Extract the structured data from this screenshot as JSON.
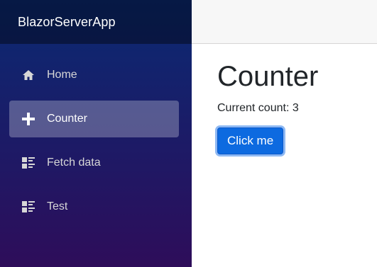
{
  "brand": "BlazorServerApp",
  "nav": {
    "items": [
      {
        "label": "Home",
        "icon": "home-icon"
      },
      {
        "label": "Counter",
        "icon": "plus-icon",
        "active": true
      },
      {
        "label": "Fetch data",
        "icon": "list-rich-icon"
      },
      {
        "label": "Test",
        "icon": "list-rich-icon"
      }
    ]
  },
  "page": {
    "title": "Counter",
    "count_text": "Current count: 3",
    "button_label": "Click me"
  },
  "colors": {
    "sidebar_top": "#0a2a73",
    "sidebar_bottom": "#2e0d5a",
    "button": "#0d6ae0",
    "top_row": "#f7f7f7"
  }
}
